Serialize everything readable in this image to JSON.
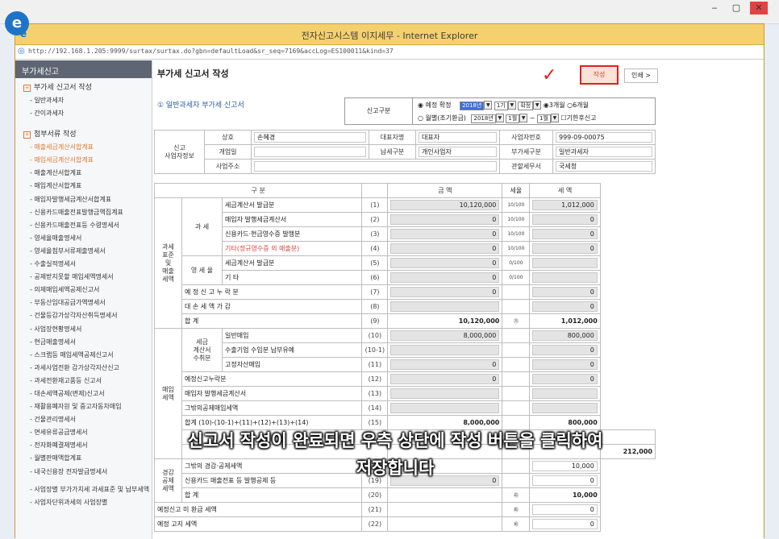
{
  "window": {
    "title": "전자신고시스템 이지세무 - Internet Explorer",
    "url": "http://192.168.1.205:9999/surtax/surtax.do?gbn=defaultLoad&sr_seq=7169&accLog=ES100011&kind=37"
  },
  "desktop": {
    "minimize": "‒",
    "maximize": "▢",
    "close": "✕"
  },
  "sidebar": {
    "header": "부가세신고",
    "section1": "부가세 신고서 작성",
    "section1_items": [
      "- 일반과세자",
      "- 간이과세자"
    ],
    "section2": "첨부서류 작성",
    "section2_items": [
      "- 매출세금계산서합계표",
      "- 매입세금계산서합계표",
      "- 매출계산서합계표",
      "- 매입계산서합계표",
      "- 매입자발행세금계산서합계표",
      "- 신용카드매출전표발행금액집계표",
      "- 신용카드매출전표등 수령명세서",
      "- 영세율매출명세서",
      "- 영세율첨부서류제출명세서",
      "- 수출실적명세서",
      "- 공제받지못할 매입세액명세서",
      "- 의제매입세액공제신고서",
      "- 부동산임대공급가액명세서",
      "- 건물등감가상각자산취득명세서",
      "- 사업장현황명세서",
      "- 현금매출명세서",
      "- 스크랩등 매입세액공제신고서",
      "- 과세사업전환 감가상각자산신고",
      "- 과세전환재고품등 신고서",
      "- 대손세액공제(변제)신고서",
      "- 재활용폐자원 및 중고자동차매입",
      "- 건물관리명세서",
      "- 면세유류공급명세서",
      "- 전자화폐결제명세서",
      "- 월별판매액합계표",
      "- 내국신용장 전자발급명세서"
    ],
    "section3_items": [
      "- 사업장별 부가가치세 과세표준 및 납부세액",
      "- 사업자단위과세의 사업장별"
    ],
    "highlighted": [
      1
    ]
  },
  "main": {
    "title": "부가세 신고서 작성",
    "check": "✓",
    "write_button": "작성",
    "print_button": "인쇄 >",
    "form_heading": "① 일반과세자 부가세 신고서",
    "report_type": {
      "label": "신고구분",
      "radio_quarter": "예정 확정",
      "year": "2018년",
      "period": "1기",
      "kind": "확정",
      "opt3": "3개월",
      "opt6": "6개월",
      "radio_month": "월별(조기환급)",
      "year2": "2018년",
      "m_from": "1월",
      "tilde": "~",
      "m_to": "1월",
      "late": "기한후신고"
    },
    "taxpayer": {
      "section_label": "신고\n사업자정보",
      "name_label": "상호",
      "name": "손혜경",
      "rep_label": "대표자명",
      "rep": "대표자",
      "bizno_label": "사업자번호",
      "bizno": "999-09-00075",
      "dob_label": "개업일",
      "dob": "",
      "taxtype_label": "납세구분",
      "taxtype": "개인사업자",
      "vattype_label": "부가세구분",
      "vattype": "일반과세자",
      "addr_label": "사업주소",
      "addr": "",
      "office_label": "관할세무서",
      "office": "국세청"
    },
    "table_head": {
      "col_class": "구 분",
      "col_amount": "금 액",
      "col_rate": "세율",
      "col_tax": "세 액"
    },
    "sales_group": "과세\n표준\n및\n매출\n세액",
    "taxed_group": "과 세",
    "zero_group": "영 세 율",
    "sales_rows": [
      {
        "label": "세금계산서 발급분",
        "code": "(1)",
        "amount": "10,120,000",
        "rate": "10/100",
        "tax": "1,012,000"
      },
      {
        "label": "매입자 발행세금계산서",
        "code": "(2)",
        "amount": "0",
        "rate": "10/100",
        "tax": "0"
      },
      {
        "label": "신용카드·현금영수증 발행분",
        "code": "(3)",
        "amount": "0",
        "rate": "10/100",
        "tax": "0"
      },
      {
        "label": "기타(정규영수증 외 매출분)",
        "code": "(4)",
        "amount": "0",
        "rate": "10/100",
        "tax": "0"
      },
      {
        "label": "세금계산서 발급분",
        "code": "(5)",
        "amount": "0",
        "rate": "0/100",
        "tax": ""
      },
      {
        "label": "기 타",
        "code": "(6)",
        "amount": "0",
        "rate": "0/100",
        "tax": ""
      },
      {
        "label": "예 정 신 고 누 락 분",
        "code": "(7)",
        "amount": "0",
        "rate": "",
        "tax": "0"
      },
      {
        "label": "대 손 세 액 가 감",
        "code": "(8)",
        "amount": "",
        "rate": "",
        "tax": "0"
      },
      {
        "label": "합 계",
        "code": "(9)",
        "amount": "10,120,000",
        "rate": "㉮",
        "tax": "1,012,000"
      }
    ],
    "purchase_group": "매입\n세액",
    "invoice_group": "세금\n계산서\n수취분",
    "purchase_rows": [
      {
        "label": "일반매입",
        "code": "(10)",
        "amount": "8,000,000",
        "tax": "800,000"
      },
      {
        "label": "수출기업 수입분 납부유예",
        "code": "(10-1)",
        "amount": "",
        "tax": "0"
      },
      {
        "label": "고정자산매입",
        "code": "(11)",
        "amount": "0",
        "tax": "0"
      },
      {
        "label": "예정신고누락분",
        "code": "(12)",
        "amount": "0",
        "tax": "0"
      },
      {
        "label": "매입자 발행세금계산서",
        "code": "(13)",
        "amount": "",
        "tax": ""
      },
      {
        "label": "그밖의공제매입세액",
        "code": "(14)",
        "amount": "",
        "tax": ""
      },
      {
        "label": "합계 (10)-(10-1)+(11)+(12)+(13)+(14)",
        "code": "(15)",
        "amount": "8,000,000",
        "tax": "800,000"
      }
    ],
    "deduct_group": "경감\n공제\n세액",
    "deduct_rows": [
      {
        "label": "그밖의 경감·공제세액",
        "code": "(18)",
        "amount": "",
        "rate": "",
        "tax": "10,000"
      },
      {
        "label": "신용카드 매출전표 등 발행공제 등",
        "code": "(19)",
        "amount": "0",
        "rate": "",
        "tax": "0"
      },
      {
        "label": "합 계",
        "code": "(20)",
        "amount": "",
        "rate": "㉱",
        "tax": "10,000"
      }
    ],
    "bottom_rows": [
      {
        "label": "예정신고 미 환급 세액",
        "code": "(21)",
        "rate": "㉲",
        "tax": "0"
      },
      {
        "label": "예정 고지 세액",
        "code": "(22)",
        "rate": "㉳",
        "tax": "0"
      }
    ],
    "hidden_tax": "212,000"
  },
  "subtitle": {
    "line1": "신고서 작성이 완료되면 우측 상단에 작성 버튼을 클릭하여",
    "line2": "저장합니다"
  }
}
